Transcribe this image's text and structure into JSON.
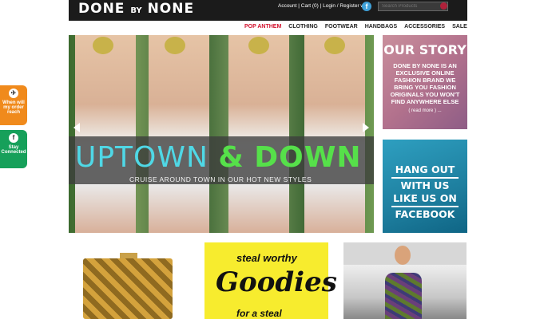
{
  "header": {
    "logo_main": "DONE",
    "logo_by": "BY",
    "logo_end": "NONE",
    "account_links": "Account | Cart (0) | Login / Register with",
    "facebook_glyph": "f",
    "search_placeholder": "Search Products"
  },
  "nav": {
    "items": [
      "POP ANTHEM",
      "CLOTHING",
      "FOOTWEAR",
      "HANDBAGS",
      "ACCESSORIES",
      "SALE"
    ]
  },
  "hero": {
    "title_uptown": "UPTOWN",
    "title_amp": "&",
    "title_down": "DOWN",
    "subtitle": "CRUISE AROUND TOWN IN OUR HOT NEW STYLES"
  },
  "story": {
    "heading": "OUR STORY",
    "body": "DONE BY NONE IS AN EXCLUSIVE ONLINE FASHION BRAND WE BRING YOU FASHION ORIGINALS YOU WON'T FIND ANYWHERE ELSE",
    "more": "( read more ) ..."
  },
  "facebook_promo": {
    "line1": "HANG OUT",
    "line2": "WITH US",
    "line3": "LIKE US ON",
    "line4": "FACEBOOK"
  },
  "side_tabs": {
    "order": {
      "label": "When will my order reach",
      "icon": "plane-icon"
    },
    "connected": {
      "label": "Stay Connected",
      "icon": "fb-twitter-icon"
    }
  },
  "promo": {
    "steal": "steal worthy",
    "goodies": "Goodies",
    "for_steal": "for a steal"
  },
  "colors": {
    "nav_active": "#d2122e",
    "orange_tab": "#f08a1c",
    "green_tab": "#16a05a",
    "accent_cyan": "#4fd8e6",
    "accent_green": "#56e04a"
  }
}
